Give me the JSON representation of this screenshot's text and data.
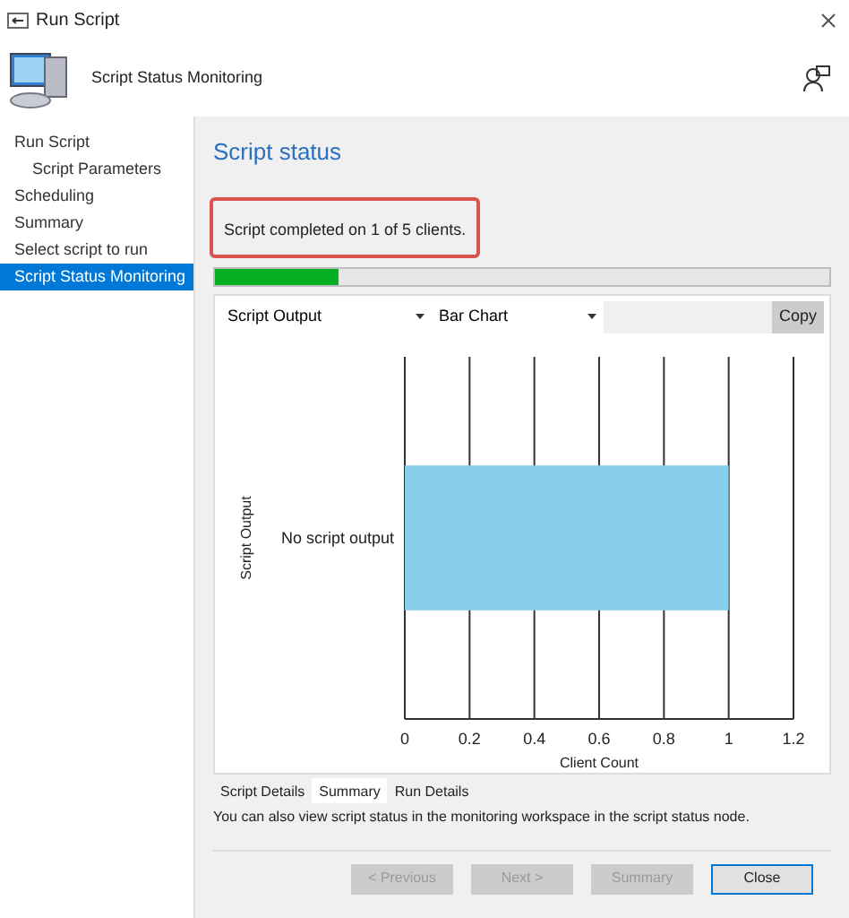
{
  "window": {
    "title": "Run Script"
  },
  "header": {
    "title": "Script Status Monitoring"
  },
  "sidebar": {
    "items": [
      {
        "label": "Run Script",
        "selected": false,
        "children": [
          {
            "label": "Script Parameters",
            "selected": false
          }
        ]
      },
      {
        "label": "Scheduling",
        "selected": false
      },
      {
        "label": "Summary",
        "selected": false
      },
      {
        "label": "Select script to run",
        "selected": false
      },
      {
        "label": "Script Status Monitoring",
        "selected": true
      }
    ]
  },
  "content": {
    "heading": "Script status",
    "status_message": "Script completed on 1 of 5 clients.",
    "progress": {
      "level": 0.2
    },
    "toolbar": {
      "output_select": "Script Output",
      "chart_select": "Bar Chart",
      "copy_button": "Copy"
    },
    "chart_data": {
      "type": "bar",
      "orientation": "horizontal",
      "xlabel": "Client Count",
      "ylabel": "Script Output",
      "categories": [
        "No script output"
      ],
      "values": [
        1
      ],
      "xlim": [
        0,
        1.2
      ],
      "xticks": [
        0,
        {
          "value": 0.2,
          "label": "0.2"
        },
        {
          "value": 0.4,
          "label": "0.4"
        },
        {
          "value": 0.6,
          "label": "0.6"
        },
        {
          "value": 0.8,
          "label": "0.8"
        },
        1,
        {
          "value": 1.2,
          "label": "1.2"
        }
      ],
      "color": "#87ceeb",
      "grid": true
    },
    "tabs": [
      {
        "label": "Script Details",
        "selected": false
      },
      {
        "label": "Summary",
        "selected": true
      },
      {
        "label": "Run Details",
        "selected": false
      }
    ],
    "note": "You can also view script status in the monitoring workspace in the script status node."
  },
  "buttons": [
    {
      "label": "< Previous",
      "disabled": true
    },
    {
      "label": "Next >",
      "disabled": true
    },
    {
      "label": "Summary",
      "disabled": true
    },
    {
      "label": "Close",
      "disabled": false
    }
  ]
}
